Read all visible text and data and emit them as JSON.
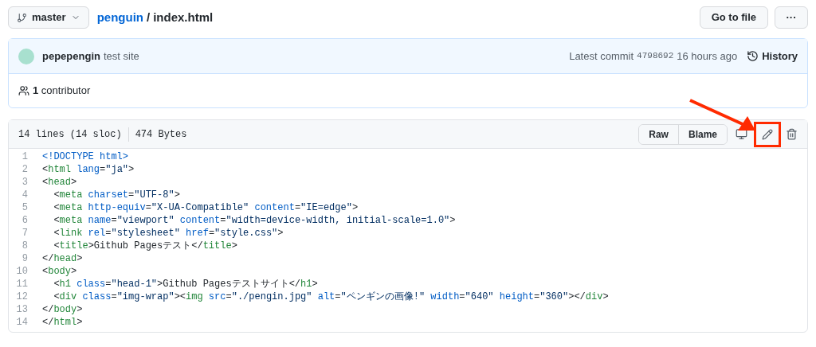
{
  "branch": {
    "label": "master"
  },
  "breadcrumb": {
    "repo": "penguin",
    "separator": "/",
    "file": "index.html"
  },
  "actions": {
    "go_to_file": "Go to file",
    "more": "···"
  },
  "commit": {
    "author": "pepepengin",
    "message": "test site",
    "latest": "Latest commit",
    "hash": "4798692",
    "time": "16 hours ago",
    "history": "History"
  },
  "contributors": {
    "count": "1",
    "label": "contributor"
  },
  "file_info": {
    "lines": "14 lines (14 sloc)",
    "size": "474 Bytes"
  },
  "file_buttons": [
    "Raw",
    "Blame"
  ],
  "code_lines": [
    {
      "number": "1",
      "tokens": [
        {
          "kind": "doctype",
          "text": "<!DOCTYPE html>"
        }
      ]
    },
    {
      "number": "2",
      "tokens": [
        {
          "kind": "punct",
          "text": "<"
        },
        {
          "kind": "tag",
          "text": "html"
        },
        {
          "kind": "attr",
          "text": " lang"
        },
        {
          "kind": "punct",
          "text": "="
        },
        {
          "kind": "string",
          "text": "\"ja\""
        },
        {
          "kind": "punct",
          "text": ">"
        }
      ]
    },
    {
      "number": "3",
      "tokens": [
        {
          "kind": "punct",
          "text": "<"
        },
        {
          "kind": "tag",
          "text": "head"
        },
        {
          "kind": "punct",
          "text": ">"
        }
      ]
    },
    {
      "number": "4",
      "tokens": [
        {
          "kind": "punct",
          "text": "  <"
        },
        {
          "kind": "tag",
          "text": "meta"
        },
        {
          "kind": "attr",
          "text": " charset"
        },
        {
          "kind": "punct",
          "text": "="
        },
        {
          "kind": "string",
          "text": "\"UTF-8\""
        },
        {
          "kind": "punct",
          "text": ">"
        }
      ]
    },
    {
      "number": "5",
      "tokens": [
        {
          "kind": "punct",
          "text": "  <"
        },
        {
          "kind": "tag",
          "text": "meta"
        },
        {
          "kind": "attr",
          "text": " http-equiv"
        },
        {
          "kind": "punct",
          "text": "="
        },
        {
          "kind": "string",
          "text": "\"X-UA-Compatible\""
        },
        {
          "kind": "attr",
          "text": " content"
        },
        {
          "kind": "punct",
          "text": "="
        },
        {
          "kind": "string",
          "text": "\"IE=edge\""
        },
        {
          "kind": "punct",
          "text": ">"
        }
      ]
    },
    {
      "number": "6",
      "tokens": [
        {
          "kind": "punct",
          "text": "  <"
        },
        {
          "kind": "tag",
          "text": "meta"
        },
        {
          "kind": "attr",
          "text": " name"
        },
        {
          "kind": "punct",
          "text": "="
        },
        {
          "kind": "string",
          "text": "\"viewport\""
        },
        {
          "kind": "attr",
          "text": " content"
        },
        {
          "kind": "punct",
          "text": "="
        },
        {
          "kind": "string",
          "text": "\"width=device-width, initial-scale=1.0\""
        },
        {
          "kind": "punct",
          "text": ">"
        }
      ]
    },
    {
      "number": "7",
      "tokens": [
        {
          "kind": "punct",
          "text": "  <"
        },
        {
          "kind": "tag",
          "text": "link"
        },
        {
          "kind": "attr",
          "text": " rel"
        },
        {
          "kind": "punct",
          "text": "="
        },
        {
          "kind": "string",
          "text": "\"stylesheet\""
        },
        {
          "kind": "attr",
          "text": " href"
        },
        {
          "kind": "punct",
          "text": "="
        },
        {
          "kind": "string",
          "text": "\"style.css\""
        },
        {
          "kind": "punct",
          "text": ">"
        }
      ]
    },
    {
      "number": "8",
      "tokens": [
        {
          "kind": "punct",
          "text": "  <"
        },
        {
          "kind": "tag",
          "text": "title"
        },
        {
          "kind": "punct",
          "text": ">Github Pagesテスト</"
        },
        {
          "kind": "tag",
          "text": "title"
        },
        {
          "kind": "punct",
          "text": ">"
        }
      ]
    },
    {
      "number": "9",
      "tokens": [
        {
          "kind": "punct",
          "text": "</"
        },
        {
          "kind": "tag",
          "text": "head"
        },
        {
          "kind": "punct",
          "text": ">"
        }
      ]
    },
    {
      "number": "10",
      "tokens": [
        {
          "kind": "punct",
          "text": "<"
        },
        {
          "kind": "tag",
          "text": "body"
        },
        {
          "kind": "punct",
          "text": ">"
        }
      ]
    },
    {
      "number": "11",
      "tokens": [
        {
          "kind": "punct",
          "text": "  <"
        },
        {
          "kind": "tag",
          "text": "h1"
        },
        {
          "kind": "attr",
          "text": " class"
        },
        {
          "kind": "punct",
          "text": "="
        },
        {
          "kind": "string",
          "text": "\"head-1\""
        },
        {
          "kind": "punct",
          "text": ">Github Pagesテストサイト</"
        },
        {
          "kind": "tag",
          "text": "h1"
        },
        {
          "kind": "punct",
          "text": ">"
        }
      ]
    },
    {
      "number": "12",
      "tokens": [
        {
          "kind": "punct",
          "text": "  <"
        },
        {
          "kind": "tag",
          "text": "div"
        },
        {
          "kind": "attr",
          "text": " class"
        },
        {
          "kind": "punct",
          "text": "="
        },
        {
          "kind": "string",
          "text": "\"img-wrap\""
        },
        {
          "kind": "punct",
          "text": "><"
        },
        {
          "kind": "tag",
          "text": "img"
        },
        {
          "kind": "attr",
          "text": " src"
        },
        {
          "kind": "punct",
          "text": "="
        },
        {
          "kind": "string",
          "text": "\"./pengin.jpg\""
        },
        {
          "kind": "attr",
          "text": " alt"
        },
        {
          "kind": "punct",
          "text": "="
        },
        {
          "kind": "string",
          "text": "\"ペンギンの画像!\""
        },
        {
          "kind": "attr",
          "text": " width"
        },
        {
          "kind": "punct",
          "text": "="
        },
        {
          "kind": "string",
          "text": "\"640\""
        },
        {
          "kind": "attr",
          "text": " height"
        },
        {
          "kind": "punct",
          "text": "="
        },
        {
          "kind": "string",
          "text": "\"360\""
        },
        {
          "kind": "punct",
          "text": "></"
        },
        {
          "kind": "tag",
          "text": "div"
        },
        {
          "kind": "punct",
          "text": ">"
        }
      ]
    },
    {
      "number": "13",
      "tokens": [
        {
          "kind": "punct",
          "text": "</"
        },
        {
          "kind": "tag",
          "text": "body"
        },
        {
          "kind": "punct",
          "text": ">"
        }
      ]
    },
    {
      "number": "14",
      "tokens": [
        {
          "kind": "punct",
          "text": "</"
        },
        {
          "kind": "tag",
          "text": "html"
        },
        {
          "kind": "punct",
          "text": ">"
        }
      ]
    }
  ]
}
